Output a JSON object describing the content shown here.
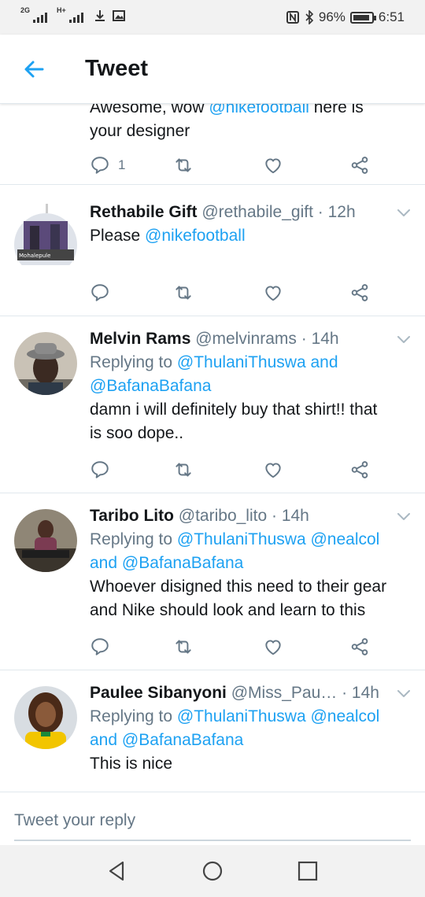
{
  "status_bar": {
    "network_1": "2G",
    "network_2": "H+",
    "battery_pct": "96%",
    "time": "6:51"
  },
  "header": {
    "title": "Tweet"
  },
  "tweets": [
    {
      "text_line1_pre": "Awesome, wow ",
      "mention1": "@nikefootball",
      "text_line1_post": " here is",
      "text_line2": "your designer",
      "reply_count": "1"
    },
    {
      "name": "Rethabile Gift",
      "handle": "@rethabile_gift",
      "time": "· 12h",
      "text_pre": "Please ",
      "mention": "@nikefootball",
      "avatar_text": "Mohalepule"
    },
    {
      "name": "Melvin Rams",
      "handle": "@melvinrams",
      "time": "· 14h",
      "replying_label": "Replying to",
      "replying_to_1": "@ThulaniThuswa",
      "replying_and": "and",
      "replying_to_2": "@BafanaBafana",
      "text_line1": "damn i will definitely buy that shirt!! that",
      "text_line2": "is soo dope.."
    },
    {
      "name": "Taribo Lito",
      "handle": "@taribo_lito",
      "time": "· 14h",
      "replying_label": "Replying to",
      "replying_to_1": "@ThulaniThuswa",
      "replying_to_2": "@nealcol",
      "replying_and": "and",
      "replying_to_3": "@BafanaBafana",
      "text_line1": "Whoever disigned this need to their gear",
      "text_line2": "and Nike should look and learn to this"
    },
    {
      "name": "Paulee Sibanyoni",
      "handle": "@Miss_Pau…",
      "time": "· 14h",
      "replying_label": "Replying to",
      "replying_to_1": "@ThulaniThuswa",
      "replying_to_2": "@nealcol",
      "replying_and": "and",
      "replying_to_3": "@BafanaBafana",
      "text_line1": "This is nice"
    }
  ],
  "reply_box": {
    "placeholder": "Tweet your reply"
  },
  "colors": {
    "accent": "#1da1f2",
    "muted": "#657786",
    "text": "#14171a",
    "divider": "#e1e8ed"
  },
  "icons": [
    "back-arrow-icon",
    "reply-icon",
    "retweet-icon",
    "like-icon",
    "share-icon",
    "chevron-down-icon",
    "nav-back-icon",
    "nav-home-icon",
    "nav-recents-icon"
  ]
}
